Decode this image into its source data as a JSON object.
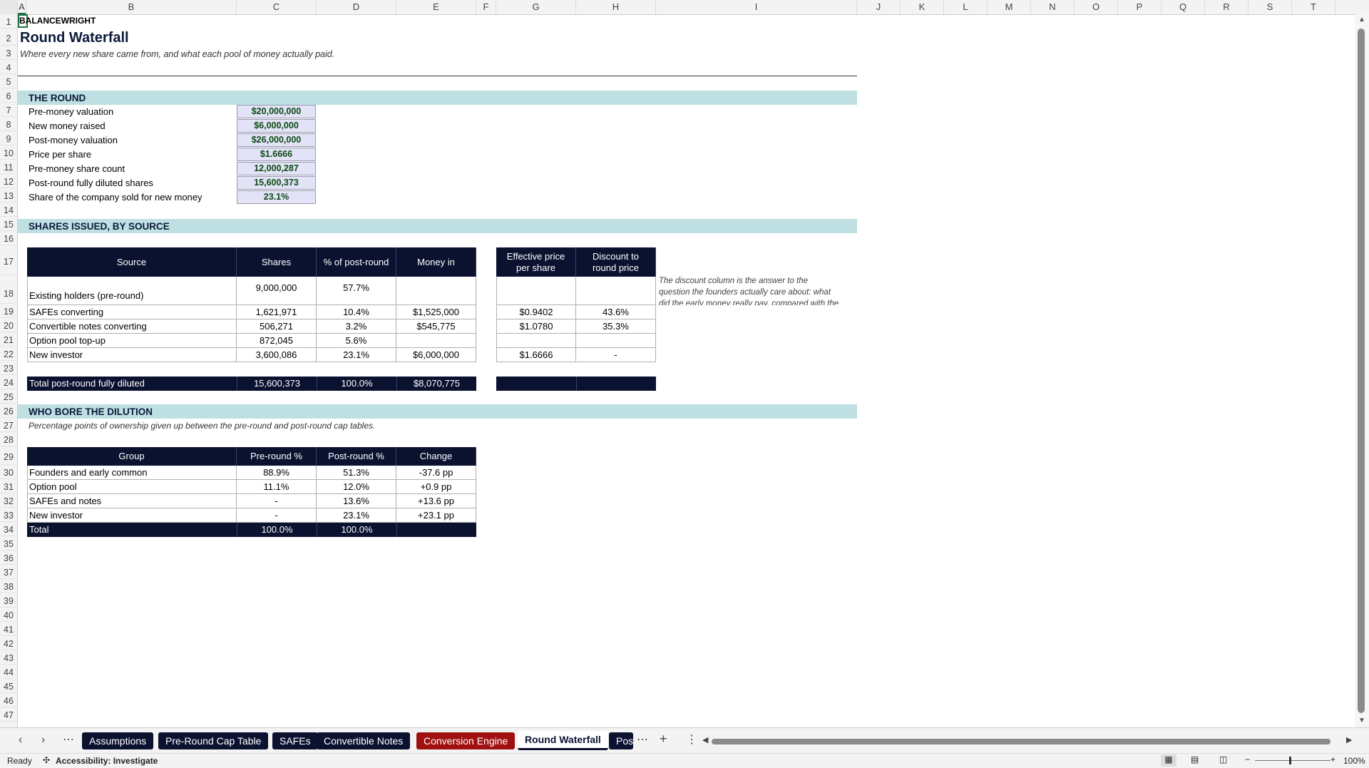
{
  "columns": [
    "A",
    "B",
    "C",
    "D",
    "E",
    "F",
    "G",
    "H",
    "I",
    "J",
    "K",
    "L",
    "M",
    "N",
    "O",
    "P",
    "Q",
    "R",
    "S",
    "T"
  ],
  "rows": [
    "1",
    "2",
    "3",
    "4",
    "5",
    "6",
    "7",
    "8",
    "9",
    "10",
    "11",
    "12",
    "13",
    "14",
    "15",
    "16",
    "17",
    "18",
    "19",
    "20",
    "21",
    "22",
    "23",
    "24",
    "25",
    "26",
    "27",
    "28",
    "29",
    "30",
    "31",
    "32",
    "33",
    "34",
    "35",
    "36",
    "37",
    "38",
    "39",
    "40",
    "41",
    "42",
    "43",
    "44",
    "45",
    "46",
    "47"
  ],
  "sheet": {
    "brand": "BALANCEWRIGHT",
    "title": "Round Waterfall",
    "subtitle": "Where every new share came from, and what each pool of money actually paid.",
    "round": {
      "header": "THE ROUND",
      "items": [
        {
          "label": "Pre-money valuation",
          "value": "$20,000,000"
        },
        {
          "label": "New money raised",
          "value": "$6,000,000"
        },
        {
          "label": "Post-money valuation",
          "value": "$26,000,000"
        },
        {
          "label": "Price per share",
          "value": "$1.6666"
        },
        {
          "label": "Pre-money share count",
          "value": "12,000,287"
        },
        {
          "label": "Post-round fully diluted shares",
          "value": "15,600,373"
        },
        {
          "label": "Share of the company sold for new money",
          "value": "23.1%"
        }
      ]
    },
    "shares": {
      "header": "SHARES ISSUED, BY SOURCE",
      "cols": [
        "Source",
        "Shares",
        "% of post-round",
        "Money in",
        "Effective price per share",
        "Discount to round price"
      ],
      "rows": [
        {
          "source": "Existing holders (pre-round)",
          "shares": "9,000,000",
          "pct": "57.7%",
          "money": "",
          "price": "",
          "discount": ""
        },
        {
          "source": "SAFEs converting",
          "shares": "1,621,971",
          "pct": "10.4%",
          "money": "$1,525,000",
          "price": "$0.9402",
          "discount": "43.6%"
        },
        {
          "source": "Convertible notes converting",
          "shares": "506,271",
          "pct": "3.2%",
          "money": "$545,775",
          "price": "$1.0780",
          "discount": "35.3%"
        },
        {
          "source": "Option pool top-up",
          "shares": "872,045",
          "pct": "5.6%",
          "money": "",
          "price": "",
          "discount": ""
        },
        {
          "source": "New investor",
          "shares": "3,600,086",
          "pct": "23.1%",
          "money": "$6,000,000",
          "price": "$1.6666",
          "discount": "-"
        }
      ],
      "total": {
        "label": "Total post-round fully diluted",
        "shares": "15,600,373",
        "pct": "100.0%",
        "money": "$8,070,775"
      },
      "note_lines": [
        "The discount column is the answer to the",
        "question the founders actually care about: what",
        "did the early money really pay, compared with the"
      ]
    },
    "dilution": {
      "header": "WHO BORE THE DILUTION",
      "note": "Percentage points of ownership given up between the pre-round and post-round cap tables.",
      "cols": [
        "Group",
        "Pre-round %",
        "Post-round %",
        "Change"
      ],
      "rows": [
        {
          "group": "Founders and early common",
          "pre": "88.9%",
          "post": "51.3%",
          "change": "-37.6 pp"
        },
        {
          "group": "Option pool",
          "pre": "11.1%",
          "post": "12.0%",
          "change": "+0.9 pp"
        },
        {
          "group": "SAFEs and notes",
          "pre": "-",
          "post": "13.6%",
          "change": "+13.6 pp"
        },
        {
          "group": "New investor",
          "pre": "-",
          "post": "23.1%",
          "change": "+23.1 pp"
        }
      ],
      "total": {
        "label": "Total",
        "pre": "100.0%",
        "post": "100.0%"
      }
    }
  },
  "tabs": {
    "items": [
      "Assumptions",
      "Pre-Round Cap Table",
      "SAFEs",
      "Convertible Notes",
      "Conversion Engine",
      "Round Waterfall",
      "Pos"
    ],
    "active": "Round Waterfall"
  },
  "status": {
    "ready": "Ready",
    "accessibility": "Accessibility: Investigate",
    "zoom": "100%"
  }
}
